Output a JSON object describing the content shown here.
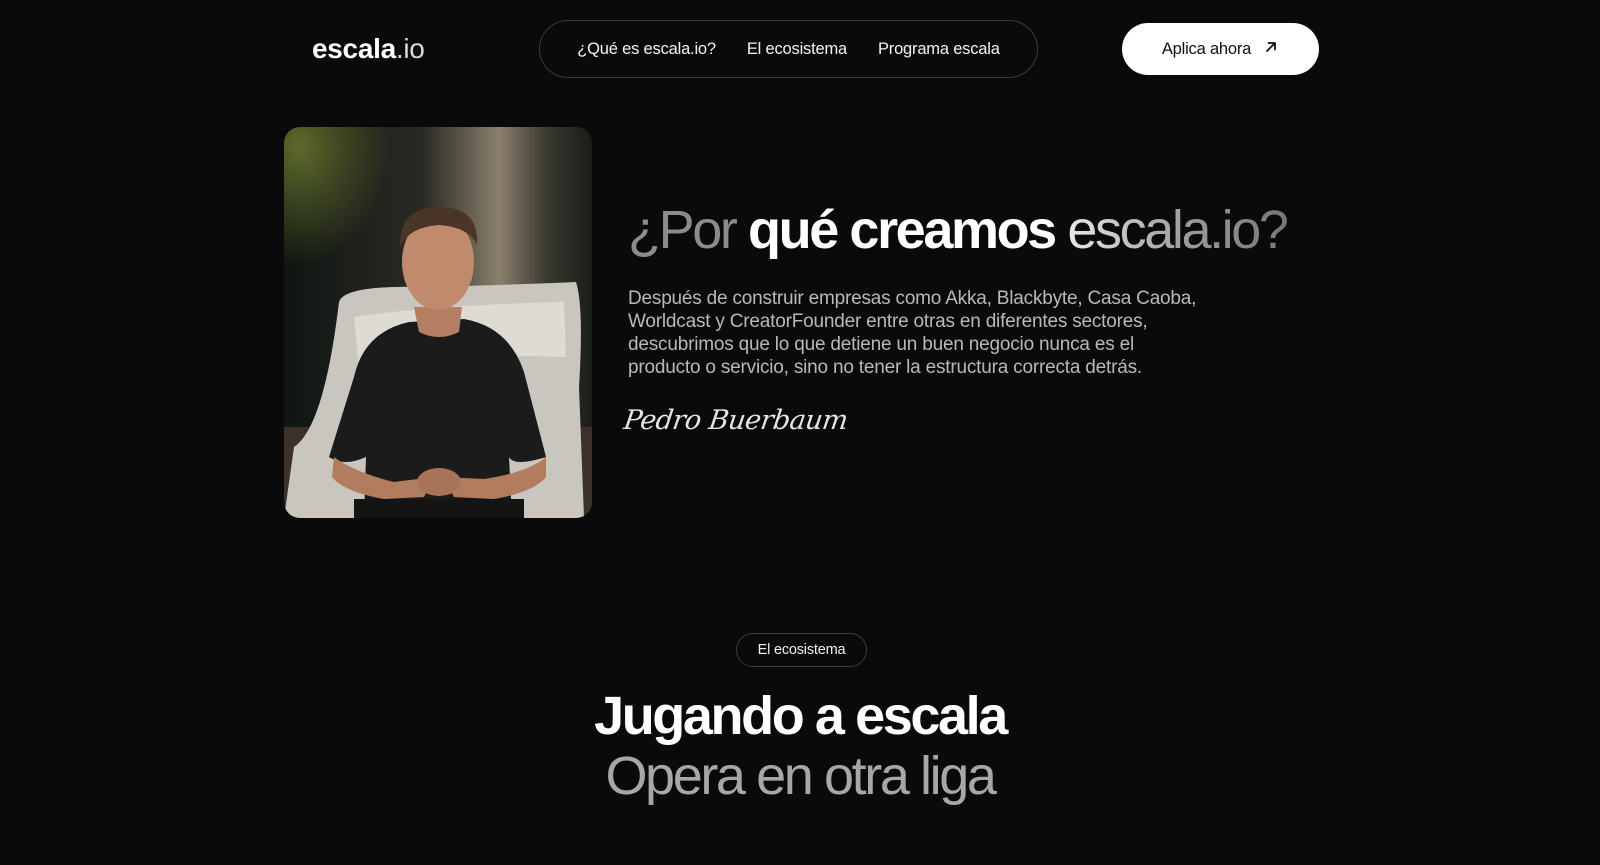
{
  "header": {
    "logo_bold": "escala",
    "logo_light": ".io",
    "nav": [
      {
        "label": "¿Qué es escala.io?"
      },
      {
        "label": "El ecosistema"
      },
      {
        "label": "Programa escala"
      }
    ],
    "cta_label": "Aplica ahora",
    "cta_icon": "arrow-up-right-icon"
  },
  "hero": {
    "title_part1": "¿Por ",
    "title_part2": "qué creamos ",
    "title_part3": "escala.io?",
    "body": "Después de construir empresas como Akka, Blackbyte, Casa Caoba, Worldcast y CreatorFounder entre otras en diferentes sectores, descubrimos que lo que detiene un buen negocio nunca es el producto o servicio, sino no tener la estructura correcta detrás.",
    "signature": "Pedro Buerbaum"
  },
  "ecosystem": {
    "pill": "El ecosistema",
    "title_line1": "Jugando a escala",
    "title_line2": "Opera en otra liga"
  },
  "colors": {
    "background": "#0a0a0a",
    "text": "#ffffff",
    "muted": "#b9b9b9",
    "cta_background": "#ffffff"
  }
}
